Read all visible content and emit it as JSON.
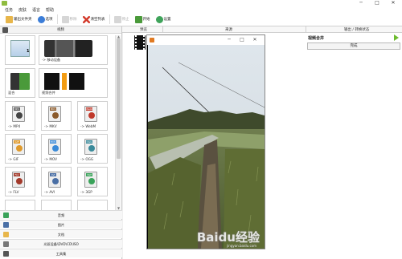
{
  "titlebar": {
    "minimize": "─",
    "maximize": "□",
    "close": "✕"
  },
  "menu": [
    "任务",
    "皮肤",
    "语言",
    "帮助"
  ],
  "toolbar": [
    {
      "label": "输出文件夹",
      "icon": "folder-icon",
      "color": "#e8b64a",
      "disabled": false
    },
    {
      "label": "选项",
      "icon": "options-icon",
      "color": "#3b7dd8",
      "disabled": false
    },
    {
      "label": "移除",
      "icon": "remove-icon",
      "color": "#999999",
      "disabled": true
    },
    {
      "label": "清空列表",
      "icon": "clear-list-icon",
      "color": "#d33b2c",
      "disabled": false
    },
    {
      "label": "停止",
      "icon": "stop-icon",
      "color": "#999999",
      "disabled": true
    },
    {
      "label": "开始",
      "icon": "start-icon",
      "color": "#4a9a3a",
      "disabled": false
    },
    {
      "label": "设置",
      "icon": "globe-icon",
      "color": "#3fa35a",
      "disabled": false
    }
  ],
  "left_panel": {
    "header": "视频",
    "tiles": [
      {
        "label": "",
        "icon": "custom-profile-icon",
        "badge": "1"
      },
      {
        "label": "-> 移动设备",
        "icon": "mobile-device-icon"
      },
      {
        "label": "混合",
        "icon": "mix-icon"
      },
      {
        "label": "视频合并",
        "icon": "video-join-icon"
      },
      {
        "label": "-> MP4",
        "icon": "mp4-icon",
        "tag": "MP4",
        "color": "#555555"
      },
      {
        "label": "-> MKV",
        "icon": "mkv-icon",
        "tag": "MKV",
        "color": "#8b5a2b"
      },
      {
        "label": "-> WebM",
        "icon": "webm-icon",
        "tag": "WebM",
        "color": "#c0392b"
      },
      {
        "label": "-> GIF",
        "icon": "gif-icon",
        "tag": "GIF",
        "color": "#e09a2b"
      },
      {
        "label": "-> MOV",
        "icon": "mov-icon",
        "tag": "MOV",
        "color": "#3a8ad8"
      },
      {
        "label": "-> OGG",
        "icon": "ogg-icon",
        "tag": "OGG",
        "color": "#3a8a9a"
      },
      {
        "label": "-> FLV",
        "icon": "flv-icon",
        "tag": "FLV",
        "color": "#a33a2b"
      },
      {
        "label": "-> AVI",
        "icon": "avi-icon",
        "tag": "AVI",
        "color": "#4a6fa5"
      },
      {
        "label": "-> 3GP",
        "icon": "3gp-icon",
        "tag": "3GP",
        "color": "#3aa35a"
      }
    ],
    "sections": [
      {
        "label": "音频",
        "icon": "audio-section-icon",
        "color": "#3aa35a"
      },
      {
        "label": "图片",
        "icon": "picture-section-icon",
        "color": "#4a6fa5"
      },
      {
        "label": "文档",
        "icon": "document-section-icon",
        "color": "#e8b64a"
      },
      {
        "label": "光驱设备\\DVD\\CD\\ISO",
        "icon": "disc-section-icon",
        "color": "#777777"
      },
      {
        "label": "工具集",
        "icon": "toolbox-section-icon",
        "color": "#555555"
      }
    ]
  },
  "columns": {
    "preview": "预览",
    "source": "来源",
    "output_status": "输出 / 转换状态"
  },
  "task": {
    "title": "视频合并",
    "status": "完成"
  },
  "player": {
    "minimize": "─",
    "maximize": "□",
    "close": "✕"
  },
  "watermark": {
    "main": "Baidu经验",
    "sub": "jingyan.baidu.com"
  },
  "colors": {
    "accent_green": "#6dbb2f",
    "panel_border": "#c8c8c8"
  }
}
